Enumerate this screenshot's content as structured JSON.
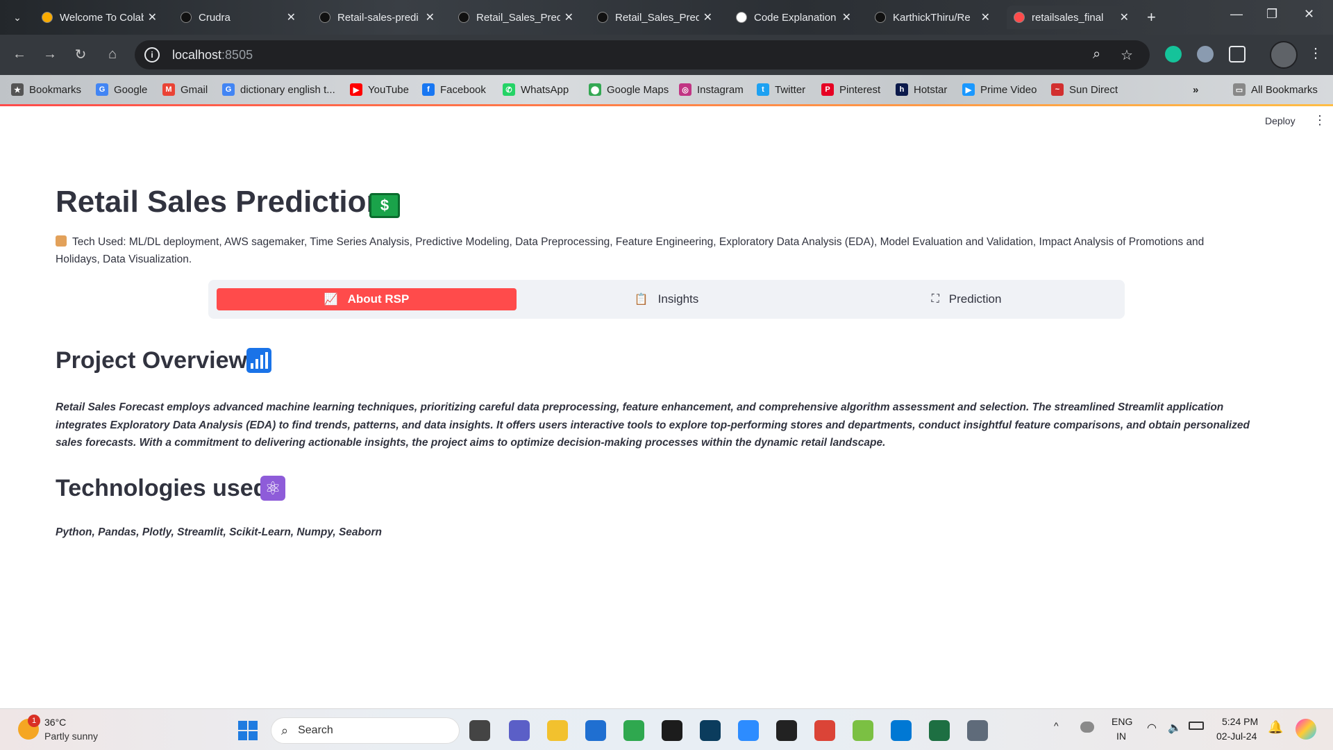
{
  "browser": {
    "tabs": [
      {
        "label": "Welcome To Colab",
        "icon": "colab-icon",
        "color": "#f9ab00"
      },
      {
        "label": "Crudra",
        "icon": "github-icon",
        "color": "#111111"
      },
      {
        "label": "Retail-sales-predi",
        "icon": "github-icon",
        "color": "#111111"
      },
      {
        "label": "Retail_Sales_Pred",
        "icon": "github-icon",
        "color": "#111111"
      },
      {
        "label": "Retail_Sales_Pred",
        "icon": "github-icon",
        "color": "#111111"
      },
      {
        "label": "Code Explanation",
        "icon": "chatgpt-icon",
        "color": "#ffffff"
      },
      {
        "label": "KarthickThiru/Re",
        "icon": "github-icon",
        "color": "#111111"
      },
      {
        "label": "retailsales_final",
        "icon": "streamlit-icon",
        "color": "#ff4b4b"
      }
    ],
    "url_host": "localhost",
    "url_port": ":8505",
    "bookmarks": [
      {
        "label": "Bookmarks",
        "icon": "star-icon",
        "color": "#555555",
        "glyph": "★"
      },
      {
        "label": "Google",
        "icon": "google-icon",
        "color": "#4285f4",
        "glyph": "G"
      },
      {
        "label": "Gmail",
        "icon": "gmail-icon",
        "color": "#ea4335",
        "glyph": "M"
      },
      {
        "label": "dictionary english t...",
        "icon": "google-icon",
        "color": "#4285f4",
        "glyph": "G"
      },
      {
        "label": "YouTube",
        "icon": "youtube-icon",
        "color": "#ff0000",
        "glyph": "▶"
      },
      {
        "label": "Facebook",
        "icon": "facebook-icon",
        "color": "#1877f2",
        "glyph": "f"
      },
      {
        "label": "WhatsApp",
        "icon": "whatsapp-icon",
        "color": "#25d366",
        "glyph": "✆"
      },
      {
        "label": "Google Maps",
        "icon": "maps-icon",
        "color": "#34a853",
        "glyph": "⬤"
      },
      {
        "label": "Instagram",
        "icon": "instagram-icon",
        "color": "#c13584",
        "glyph": "◎"
      },
      {
        "label": "Twitter",
        "icon": "twitter-icon",
        "color": "#1da1f2",
        "glyph": "t"
      },
      {
        "label": "Pinterest",
        "icon": "pinterest-icon",
        "color": "#e60023",
        "glyph": "P"
      },
      {
        "label": "Hotstar",
        "icon": "hotstar-icon",
        "color": "#0c1a4b",
        "glyph": "h"
      },
      {
        "label": "Prime Video",
        "icon": "primevideo-icon",
        "color": "#1a98ff",
        "glyph": "▶"
      },
      {
        "label": "Sun Direct",
        "icon": "sundirect-icon",
        "color": "#d22f2f",
        "glyph": "~"
      }
    ],
    "all_bookmarks": "All Bookmarks"
  },
  "app": {
    "deploy": "Deploy",
    "title": "Retail Sales Prediction",
    "tech_used": "Tech Used: ML/DL deployment, AWS sagemaker, Time Series Analysis, Predictive Modeling, Data Preprocessing, Feature Engineering, Exploratory Data Analysis (EDA), Model Evaluation and Validation, Impact Analysis of Promotions and Holidays, Data Visualization.",
    "menu": [
      {
        "label": "About RSP",
        "icon": "line-chart-icon",
        "glyph": "📈",
        "active": true
      },
      {
        "label": "Insights",
        "icon": "clipboard-chart-icon",
        "glyph": "📋",
        "active": false
      },
      {
        "label": "Prediction",
        "icon": "nodes-icon",
        "glyph": "⛶",
        "active": false
      }
    ],
    "overview_heading": "Project Overview",
    "overview_text": "Retail Sales Forecast employs advanced machine learning techniques, prioritizing careful data preprocessing, feature enhancement, and comprehensive algorithm assessment and selection. The streamlined Streamlit application integrates Exploratory Data Analysis (EDA) to find trends, patterns, and data insights. It offers users interactive tools to explore top-performing stores and departments, conduct insightful feature comparisons, and obtain personalized sales forecasts. With a commitment to delivering actionable insights, the project aims to optimize decision-making processes within the dynamic retail landscape.",
    "tech_heading": "Technologies used",
    "tech_list": "Python, Pandas, Plotly, Streamlit, Scikit-Learn, Numpy, Seaborn",
    "accent_color": "#ff4b4b"
  },
  "taskbar": {
    "weather_badge": "1",
    "temperature": "36°C",
    "weather": "Partly sunny",
    "search_placeholder": "Search",
    "apps": [
      {
        "name": "files-app",
        "color": "#444444"
      },
      {
        "name": "teams-app",
        "color": "#5b5fc7"
      },
      {
        "name": "file-explorer-app",
        "color": "#f2c12e"
      },
      {
        "name": "store-app",
        "color": "#1f6fd1"
      },
      {
        "name": "refresh-app",
        "color": "#2fa84f"
      },
      {
        "name": "dropbox-app",
        "color": "#1c1c1c"
      },
      {
        "name": "remote-app",
        "color": "#0b3c5d"
      },
      {
        "name": "zoom-app",
        "color": "#2d8cff"
      },
      {
        "name": "whatsapp-app",
        "color": "#222222"
      },
      {
        "name": "chrome-app",
        "color": "#db4437"
      },
      {
        "name": "spinner-app",
        "color": "#7bc043"
      },
      {
        "name": "vscode-app",
        "color": "#0078d4"
      },
      {
        "name": "excel-app",
        "color": "#1d6f42"
      },
      {
        "name": "settings-app",
        "color": "#5f6b7a"
      }
    ],
    "lang_top": "ENG",
    "lang_bottom": "IN",
    "time": "5:24 PM",
    "date": "02-Jul-24"
  }
}
